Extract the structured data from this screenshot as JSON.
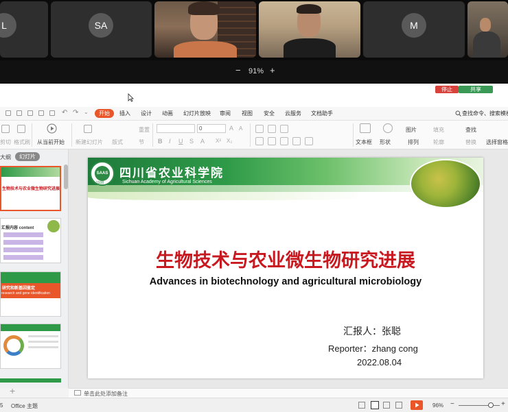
{
  "participants": [
    {
      "initial": "L"
    },
    {
      "initial": "SA"
    },
    {
      "initial": "M"
    }
  ],
  "zoom": {
    "minus": "−",
    "level": "91%",
    "plus": "+"
  },
  "share_controls": {
    "stop": "停止",
    "share": "共享"
  },
  "menu": {
    "tabs": [
      "开始",
      "插入",
      "设计",
      "动画",
      "幻灯片放映",
      "审阅",
      "视图",
      "安全",
      "云服务",
      "文档助手"
    ],
    "search": "查找命令、搜索模板"
  },
  "ribbon": {
    "cut": "剪切",
    "format_painter": "格式刷",
    "play_from_current": "从当前开始",
    "new_slide": "新建幻灯片",
    "layout": "版式",
    "reset": "重置",
    "section": "节",
    "font_size": "0",
    "textbox": "文本框",
    "shape": "形状",
    "picture": "图片",
    "fill": "填充",
    "arrange": "排列",
    "outline": "轮廓",
    "find": "查找",
    "replace": "替换",
    "select_pane": "选择窗格"
  },
  "side_panel": {
    "tab_outline": "大纲",
    "tab_slides": "幻灯片",
    "add": "+",
    "thumb1_text": "生物技术与农业微生物研究进展",
    "thumb2_text": "汇报内容 content",
    "thumb3_text": "研究和新基因鉴定",
    "thumb3_en": "research and gene identification"
  },
  "slide": {
    "institute_cn": "四川省农业科学院",
    "institute_en": "Sichuan Academy of Agricultural Sciences",
    "logo_text": "SAAS",
    "logo_year": "1938",
    "title_cn": "生物技术与农业微生物研究进展",
    "title_en": "Advances in biotechnology and agricultural microbiology",
    "reporter_cn": "汇报人：张聪",
    "reporter_en": "Reporter：zhang cong",
    "date": "2022.08.04"
  },
  "notes": {
    "placeholder": "单击此处添加备注"
  },
  "status": {
    "slide_num": "5",
    "theme": "Office 主题",
    "zoom": "96%"
  },
  "colors": {
    "accent": "#e8562a",
    "title_red": "#c7191f",
    "green": "#2e9a48"
  }
}
